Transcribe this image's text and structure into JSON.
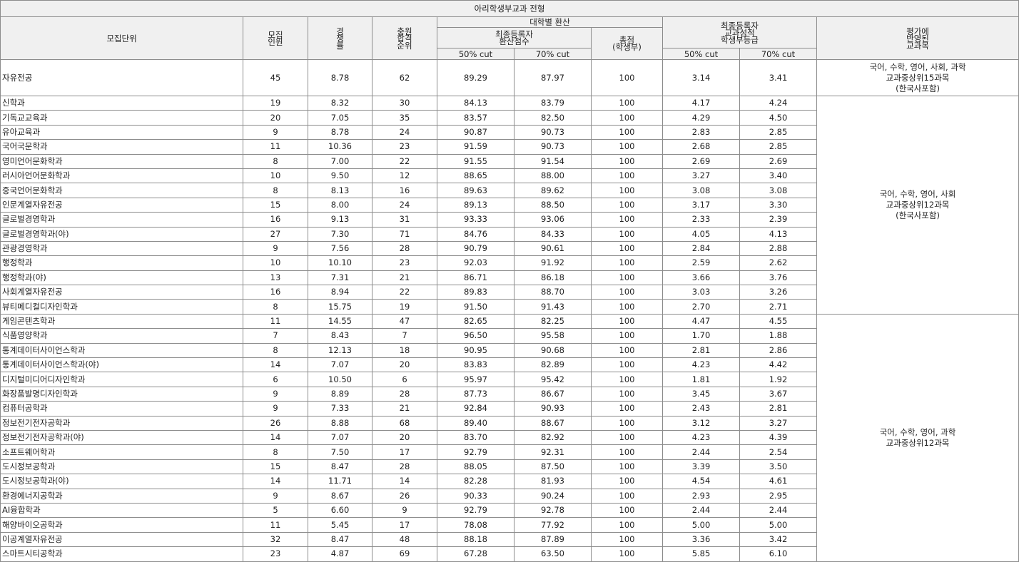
{
  "title": "아리학생부교과 전형",
  "headers": {
    "unit": "모집단위",
    "quota": [
      "모집",
      "인원"
    ],
    "ratio": [
      "경",
      "쟁",
      "률"
    ],
    "waitlist": [
      "충원",
      "합격",
      "순위"
    ],
    "univ_convert": "대학별 환산",
    "final_converted": [
      "최종등록자",
      "환산점수"
    ],
    "total": [
      "총점",
      "(학생부)"
    ],
    "final_grade": [
      "최종등록자",
      "교과성적",
      "학생부등급"
    ],
    "cut50": "50% cut",
    "cut70": "70% cut",
    "subjects": [
      "평가에",
      "반영된",
      "교과목"
    ]
  },
  "subject_groups": [
    [
      "국어, 수학, 영어, 사회, 과학",
      "교과중상위15과목",
      "(한국사포함)"
    ],
    [
      "국어, 수학, 영어, 사회",
      "교과중상위12과목",
      "(한국사포함)"
    ],
    [
      "국어, 수학, 영어, 과학",
      "교과중상위12과목"
    ]
  ],
  "rows": [
    [
      "자유전공",
      "45",
      "8.78",
      "62",
      "89.29",
      "87.97",
      "100",
      "3.14",
      "3.41"
    ],
    [
      "신학과",
      "19",
      "8.32",
      "30",
      "84.13",
      "83.79",
      "100",
      "4.17",
      "4.24"
    ],
    [
      "기독교교육과",
      "20",
      "7.05",
      "35",
      "83.57",
      "82.50",
      "100",
      "4.29",
      "4.50"
    ],
    [
      "유아교육과",
      "9",
      "8.78",
      "24",
      "90.87",
      "90.73",
      "100",
      "2.83",
      "2.85"
    ],
    [
      "국어국문학과",
      "11",
      "10.36",
      "23",
      "91.59",
      "90.73",
      "100",
      "2.68",
      "2.85"
    ],
    [
      "영미언어문화학과",
      "8",
      "7.00",
      "22",
      "91.55",
      "91.54",
      "100",
      "2.69",
      "2.69"
    ],
    [
      "러시아언어문화학과",
      "10",
      "9.50",
      "12",
      "88.65",
      "88.00",
      "100",
      "3.27",
      "3.40"
    ],
    [
      "중국언어문화학과",
      "8",
      "8.13",
      "16",
      "89.63",
      "89.62",
      "100",
      "3.08",
      "3.08"
    ],
    [
      "인문계열자유전공",
      "15",
      "8.00",
      "24",
      "89.13",
      "88.50",
      "100",
      "3.17",
      "3.30"
    ],
    [
      "글로벌경영학과",
      "16",
      "9.13",
      "31",
      "93.33",
      "93.06",
      "100",
      "2.33",
      "2.39"
    ],
    [
      "글로벌경영학과(야)",
      "27",
      "7.30",
      "71",
      "84.76",
      "84.33",
      "100",
      "4.05",
      "4.13"
    ],
    [
      "관광경영학과",
      "9",
      "7.56",
      "28",
      "90.79",
      "90.61",
      "100",
      "2.84",
      "2.88"
    ],
    [
      "행정학과",
      "10",
      "10.10",
      "23",
      "92.03",
      "91.92",
      "100",
      "2.59",
      "2.62"
    ],
    [
      "행정학과(야)",
      "13",
      "7.31",
      "21",
      "86.71",
      "86.18",
      "100",
      "3.66",
      "3.76"
    ],
    [
      "사회계열자유전공",
      "16",
      "8.94",
      "22",
      "89.83",
      "88.70",
      "100",
      "3.03",
      "3.26"
    ],
    [
      "뷰티메디컬디자인학과",
      "8",
      "15.75",
      "19",
      "91.50",
      "91.43",
      "100",
      "2.70",
      "2.71"
    ],
    [
      "게임콘텐츠학과",
      "11",
      "14.55",
      "47",
      "82.65",
      "82.25",
      "100",
      "4.47",
      "4.55"
    ],
    [
      "식품영양학과",
      "7",
      "8.43",
      "7",
      "96.50",
      "95.58",
      "100",
      "1.70",
      "1.88"
    ],
    [
      "통계데이터사이언스학과",
      "8",
      "12.13",
      "18",
      "90.95",
      "90.68",
      "100",
      "2.81",
      "2.86"
    ],
    [
      "통계데이터사이언스학과(야)",
      "14",
      "7.07",
      "20",
      "83.83",
      "82.89",
      "100",
      "4.23",
      "4.42"
    ],
    [
      "디지털미디어디자인학과",
      "6",
      "10.50",
      "6",
      "95.97",
      "95.42",
      "100",
      "1.81",
      "1.92"
    ],
    [
      "화장품발명디자인학과",
      "9",
      "8.89",
      "28",
      "87.73",
      "86.67",
      "100",
      "3.45",
      "3.67"
    ],
    [
      "컴퓨터공학과",
      "9",
      "7.33",
      "21",
      "92.84",
      "90.93",
      "100",
      "2.43",
      "2.81"
    ],
    [
      "정보전기전자공학과",
      "26",
      "8.88",
      "68",
      "89.40",
      "88.67",
      "100",
      "3.12",
      "3.27"
    ],
    [
      "정보전기전자공학과(야)",
      "14",
      "7.07",
      "20",
      "83.70",
      "82.92",
      "100",
      "4.23",
      "4.39"
    ],
    [
      "소프트웨어학과",
      "8",
      "7.50",
      "17",
      "92.79",
      "92.31",
      "100",
      "2.44",
      "2.54"
    ],
    [
      "도시정보공학과",
      "15",
      "8.47",
      "28",
      "88.05",
      "87.50",
      "100",
      "3.39",
      "3.50"
    ],
    [
      "도시정보공학과(야)",
      "14",
      "11.71",
      "14",
      "82.28",
      "81.93",
      "100",
      "4.54",
      "4.61"
    ],
    [
      "환경에너지공학과",
      "9",
      "8.67",
      "26",
      "90.33",
      "90.24",
      "100",
      "2.93",
      "2.95"
    ],
    [
      "AI융합학과",
      "5",
      "6.60",
      "9",
      "92.79",
      "92.78",
      "100",
      "2.44",
      "2.44"
    ],
    [
      "해양바이오공학과",
      "11",
      "5.45",
      "17",
      "78.08",
      "77.92",
      "100",
      "5.00",
      "5.00"
    ],
    [
      "이공계열자유전공",
      "32",
      "8.47",
      "48",
      "88.18",
      "87.89",
      "100",
      "3.36",
      "3.42"
    ],
    [
      "스마트시티공학과",
      "23",
      "4.87",
      "69",
      "67.28",
      "63.50",
      "100",
      "5.85",
      "6.10"
    ]
  ]
}
